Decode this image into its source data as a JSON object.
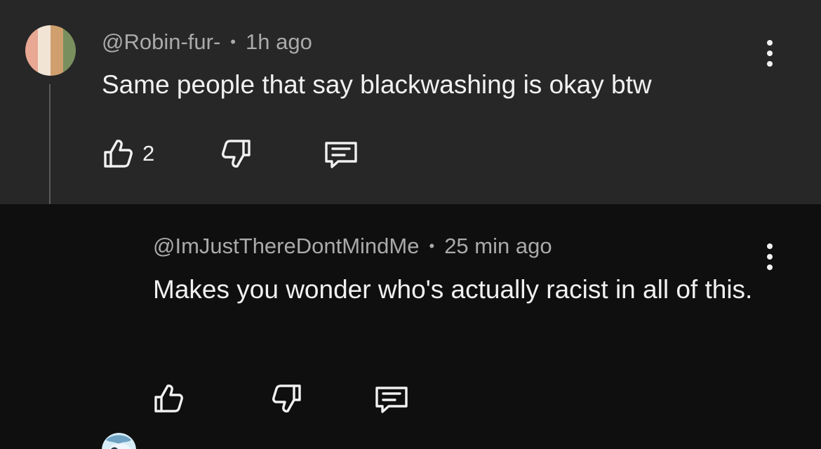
{
  "comments": [
    {
      "author": "@Robin-fur-",
      "time": "1h ago",
      "separator": "•",
      "text": "Same people that say blackwashing is okay btw",
      "likes": "2",
      "avatar_colors": [
        "#e8a894",
        "#f1e4d4",
        "#cfa06e",
        "#7a8f5e"
      ]
    },
    {
      "author": "@ImJustThereDontMindMe",
      "time": "25 min ago",
      "separator": "•",
      "text": "Makes you wonder who's actually racist in all of this.",
      "likes": "",
      "avatar_colors": [
        "#d6ecf6",
        "#6fa2c2",
        "#2a3a48"
      ]
    }
  ],
  "icons": {
    "like": "thumbs-up-icon",
    "dislike": "thumbs-down-icon",
    "reply": "reply-comment-icon",
    "more": "more-vertical-icon"
  },
  "colors": {
    "top_bg": "#272727",
    "bottom_bg": "#0f0f0f",
    "text": "#f1f1f1",
    "meta": "#aaaaaa"
  }
}
